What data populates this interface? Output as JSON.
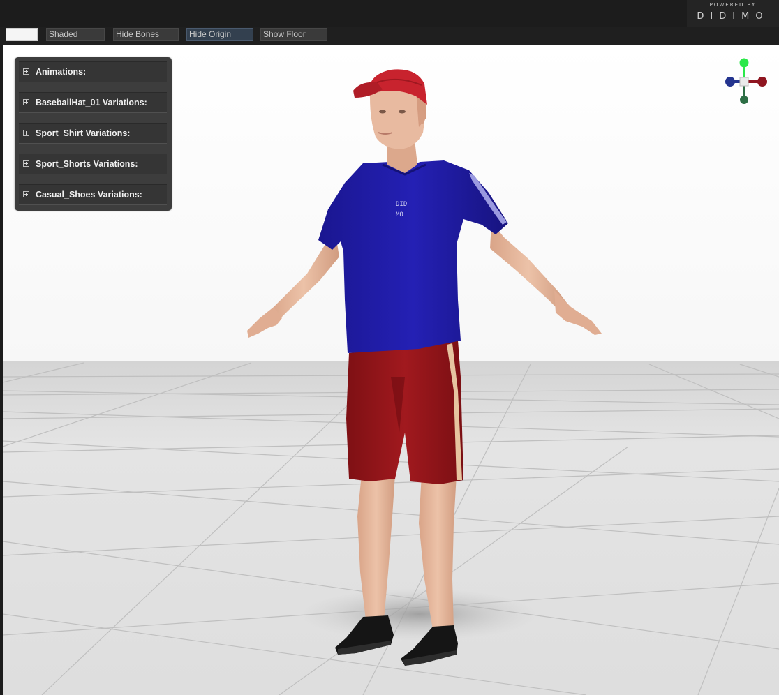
{
  "brand": {
    "powered_by": "POWERED BY",
    "name": "DIDIMO"
  },
  "toolbar": {
    "buttons": [
      {
        "label": "Shaded",
        "active": false
      },
      {
        "label": "Hide Bones",
        "active": false
      },
      {
        "label": "Hide Origin",
        "active": true
      },
      {
        "label": "Show Floor",
        "active": false
      }
    ]
  },
  "panel": {
    "items": [
      {
        "label": "Animations:"
      },
      {
        "label": "BaseballHat_01 Variations:"
      },
      {
        "label": "Sport_Shirt Variations:"
      },
      {
        "label": "Sport_Shorts Variations:"
      },
      {
        "label": "Casual_Shoes Variations:"
      }
    ]
  },
  "shirt_logo": {
    "line1": "DID",
    "line2": "MO"
  },
  "colors": {
    "shirt": "#1e1aa6",
    "shorts": "#8f1418",
    "hat": "#c8232e",
    "skin": "#e4b49a",
    "shoes": "#141414",
    "floor": "#dcdcdc",
    "gizmo_y": "#2ce84a",
    "gizmo_x": "#8f1520",
    "gizmo_z": "#24348f",
    "gizmo_neg_y": "#2d6e45"
  }
}
